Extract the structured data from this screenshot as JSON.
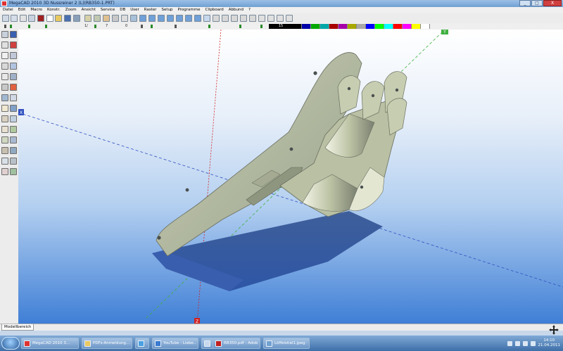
{
  "window": {
    "title": "MegaCAD 2010 3D Nussreiner 2 (L)(RB350-1.PRT)",
    "buttons": [
      "_",
      "□",
      "X"
    ]
  },
  "menu": [
    "Datei",
    "Edit",
    "Macro",
    "Konstr.",
    "Zoom",
    "Ansicht",
    "Service",
    "DB",
    "User",
    "Raster",
    "Setup",
    "Programme",
    "Clipboard",
    "Abbund",
    "?"
  ],
  "toolbar2": {
    "field_a": "1/",
    "field_b": "7",
    "field_c": "0",
    "layer_value": "15"
  },
  "colors": {
    "palette": [
      "#000000",
      "#0000a8",
      "#00a800",
      "#00a8a8",
      "#a80000",
      "#a800a8",
      "#a8a800",
      "#a8a8a8",
      "#0000ff",
      "#00ff00",
      "#00ffff",
      "#ff0000",
      "#ff00ff",
      "#ffff00",
      "#ffffff"
    ],
    "viewport_top": "#ffffff",
    "viewport_bottom": "#3f7fd6",
    "part_fill": "#bfc6a6",
    "axis_x": "#3050c0",
    "axis_y": "#40b040",
    "axis_z": "#d02020"
  },
  "axis_markers": {
    "y_top": "Y",
    "x_left": "X",
    "z_bottom": "Z"
  },
  "tabs": [
    "Modellbereich"
  ],
  "taskbar": {
    "tasks": [
      "MegaCAD 2010 3...",
      "PDFs-Anmeldung...",
      "",
      "YouTube - Liebe...",
      "",
      "RB350.pdf - Adob...",
      "Löffelstiel1.jpeg - P..."
    ],
    "clock_time": "14:10",
    "clock_date": "21.04.2011"
  }
}
